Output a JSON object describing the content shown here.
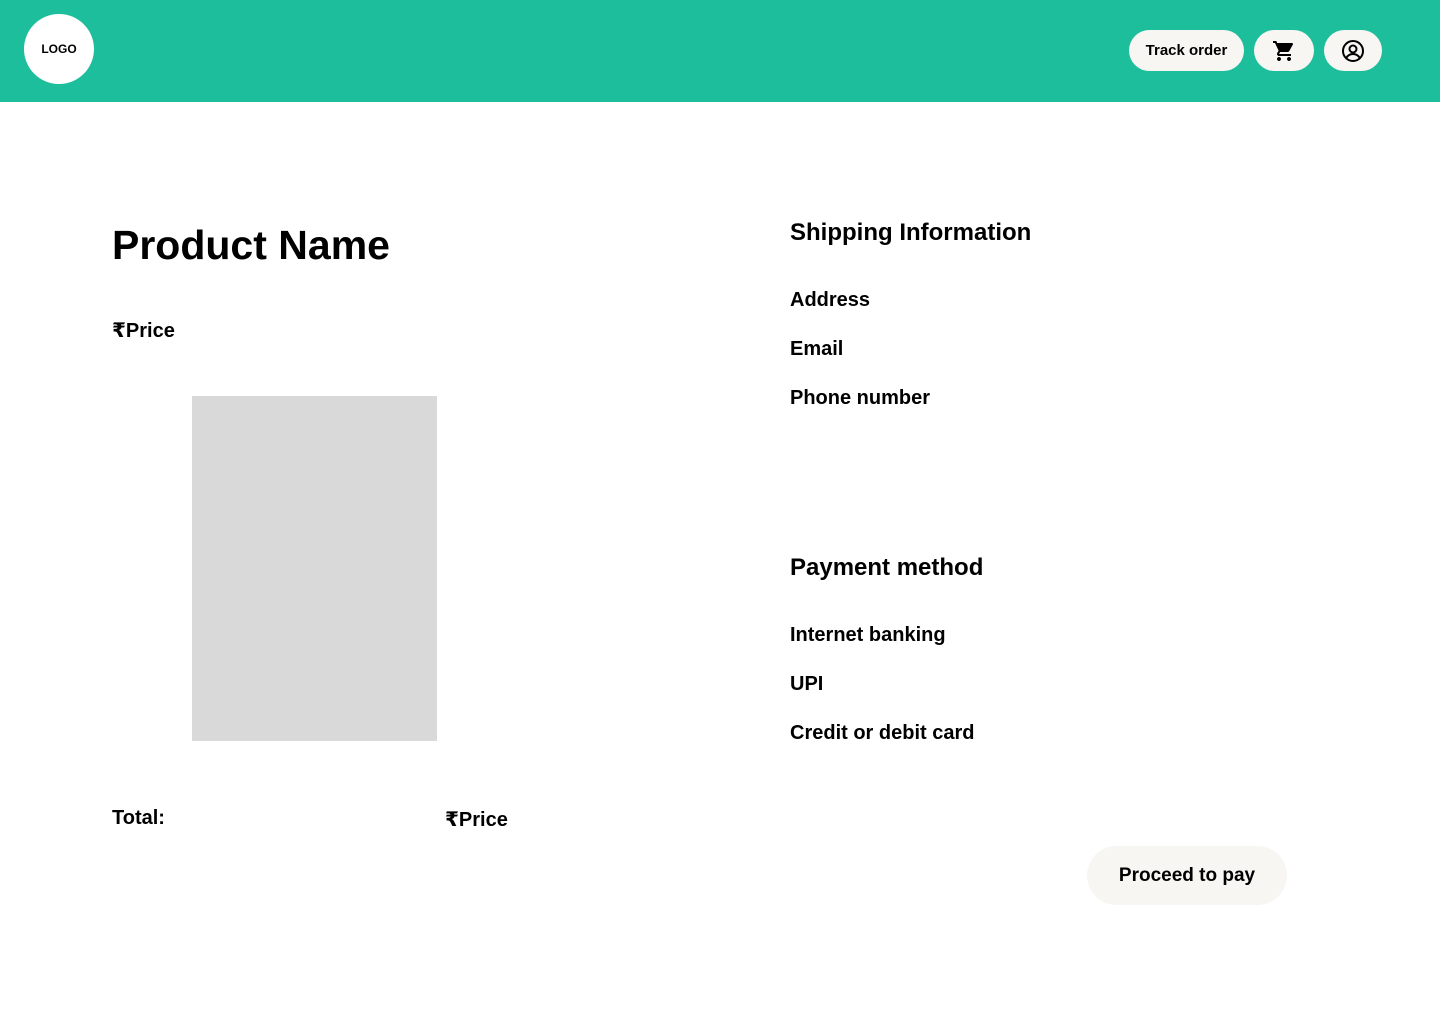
{
  "header": {
    "logo_text": "LOGO",
    "track_order_label": "Track order",
    "cart_icon": "cart-icon",
    "profile_icon": "user-circle-icon",
    "background_color": "#1DBE9B"
  },
  "product": {
    "name": "Product Name",
    "price": "₹Price",
    "image_placeholder_color": "#D9D9D9"
  },
  "total": {
    "label": "Total:",
    "price": "₹Price"
  },
  "shipping": {
    "heading": "Shipping Information",
    "fields": [
      "Address",
      "Email",
      "Phone number"
    ]
  },
  "payment": {
    "heading": "Payment method",
    "options": [
      "Internet banking",
      "UPI",
      "Credit or debit card"
    ]
  },
  "actions": {
    "proceed_label": "Proceed to pay"
  }
}
